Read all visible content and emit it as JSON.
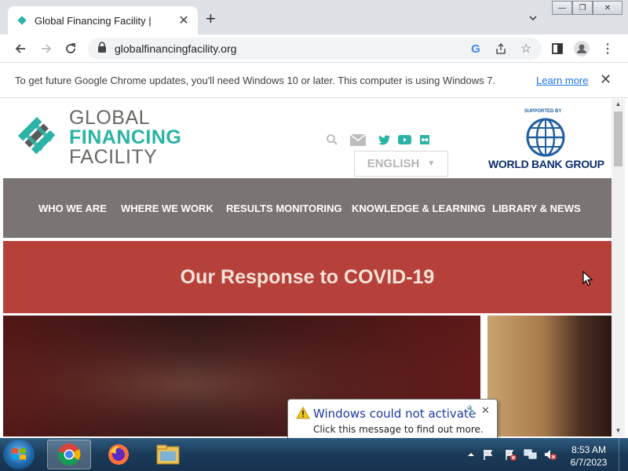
{
  "browser": {
    "tab": {
      "title": "Global Financing Facility |",
      "favicon": "gff-diamond-icon"
    },
    "new_tab": "+",
    "url": "globalfinancingfacility.org",
    "infobar": {
      "message": "To get future Google Chrome updates, you'll need Windows 10 or later. This computer is using Windows 7.",
      "link": "Learn more"
    }
  },
  "site": {
    "logo": {
      "line1": "GLOBAL",
      "line2": "FINANCING",
      "line3": "FACILITY"
    },
    "language": "ENGLISH",
    "supported_by": "SUPPORTED BY",
    "partner": "WORLD BANK GROUP",
    "nav": [
      "WHO WE ARE",
      "WHERE WE WORK",
      "RESULTS MONITORING",
      "KNOWLEDGE & LEARNING",
      "LIBRARY & NEWS"
    ],
    "banner_title": "Our Response to COVID-19"
  },
  "notification": {
    "title": "Windows could not activate",
    "message": "Click this message to find out more."
  },
  "taskbar": {
    "time": "8:53 AM",
    "date": "6/7/2023"
  },
  "colors": {
    "nav_bg": "#7a7472",
    "banner_bg": "#b5413a",
    "teal": "#2ab3a6"
  }
}
